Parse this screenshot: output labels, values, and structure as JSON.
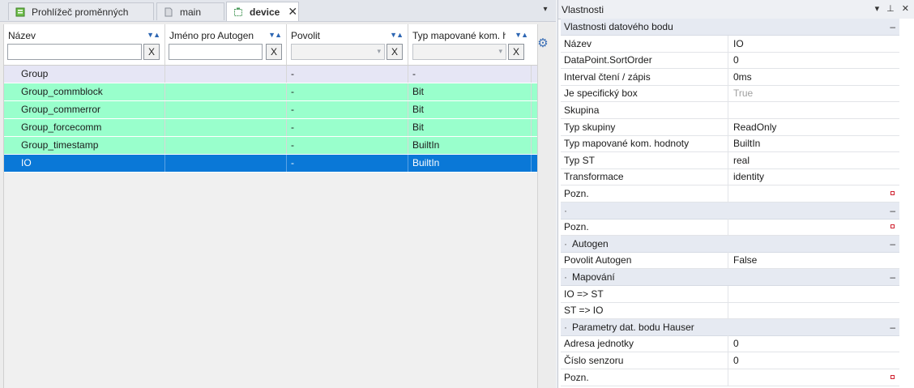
{
  "tabs": [
    {
      "label": "Prohlížeč proměnných",
      "icon": "variable-viewer-icon",
      "active": false
    },
    {
      "label": "main",
      "icon": "document-icon",
      "active": false
    },
    {
      "label": "device",
      "icon": "device-icon",
      "active": true
    }
  ],
  "tab_close": "✕",
  "pane_menu": "▾",
  "grid": {
    "columns": [
      {
        "title": "Název",
        "sort": "▼▲"
      },
      {
        "title": "Jméno pro Autogen",
        "sort": "▼▲"
      },
      {
        "title": "Povolit",
        "sort": "▼▲"
      },
      {
        "title": "Typ mapované kom. h",
        "sort": "▼▲"
      }
    ],
    "clear_label": "X",
    "rows": [
      {
        "name": "Group",
        "autogen": "",
        "povolit": "-",
        "typ": "-",
        "style": "g0"
      },
      {
        "name": "Group_commblock",
        "autogen": "",
        "povolit": "-",
        "typ": "Bit",
        "style": "g1"
      },
      {
        "name": "Group_commerror",
        "autogen": "",
        "povolit": "-",
        "typ": "Bit",
        "style": "g1"
      },
      {
        "name": "Group_forcecomm",
        "autogen": "",
        "povolit": "-",
        "typ": "Bit",
        "style": "g1"
      },
      {
        "name": "Group_timestamp",
        "autogen": "",
        "povolit": "-",
        "typ": "BuiltIn",
        "style": "g1"
      },
      {
        "name": "IO",
        "autogen": "",
        "povolit": "-",
        "typ": "BuiltIn",
        "style": "sel"
      }
    ]
  },
  "properties": {
    "title": "Vlastnosti",
    "title_buttons": "▾ ⊥ ✕",
    "rows": [
      {
        "type": "cat",
        "label": "Vlastnosti datového bodu",
        "dot": false
      },
      {
        "type": "prop",
        "label": "Název",
        "value": "IO"
      },
      {
        "type": "prop",
        "label": "DataPoint.SortOrder",
        "value": "0"
      },
      {
        "type": "prop",
        "label": "Interval čtení / zápis",
        "value": "0ms"
      },
      {
        "type": "prop",
        "label": "Je specifický box",
        "value": "True",
        "disabled": true
      },
      {
        "type": "prop",
        "label": "Skupina",
        "value": ""
      },
      {
        "type": "prop",
        "label": "Typ skupiny",
        "value": "ReadOnly"
      },
      {
        "type": "prop",
        "label": "Typ mapované kom. hodnoty",
        "value": "BuiltIn"
      },
      {
        "type": "prop",
        "label": "Typ ST",
        "value": "real"
      },
      {
        "type": "prop",
        "label": "Transformace",
        "value": "identity"
      },
      {
        "type": "prop",
        "label": "Pozn.",
        "value": "",
        "edit": true
      },
      {
        "type": "cat",
        "label": "",
        "dot": true
      },
      {
        "type": "prop",
        "label": "Pozn.",
        "value": "",
        "edit": true
      },
      {
        "type": "cat",
        "label": "Autogen",
        "dot": true
      },
      {
        "type": "prop",
        "label": "Povolit Autogen",
        "value": "False"
      },
      {
        "type": "cat",
        "label": "Mapování",
        "dot": true
      },
      {
        "type": "prop",
        "label": "IO => ST",
        "value": ""
      },
      {
        "type": "prop",
        "label": "ST => IO",
        "value": ""
      },
      {
        "type": "cat",
        "label": "Parametry dat. bodu Hauser",
        "dot": true
      },
      {
        "type": "prop",
        "label": "Adresa jednotky",
        "value": "0"
      },
      {
        "type": "prop",
        "label": "Číslo senzoru",
        "value": "0"
      },
      {
        "type": "prop",
        "label": "Pozn.",
        "value": "",
        "edit": true
      }
    ],
    "collapse_glyph": "–",
    "dot_glyph": "·"
  },
  "colors": {
    "group_row": "#e6e6f5",
    "item_row": "#99ffcc",
    "selected_row": "#0a78d7"
  }
}
